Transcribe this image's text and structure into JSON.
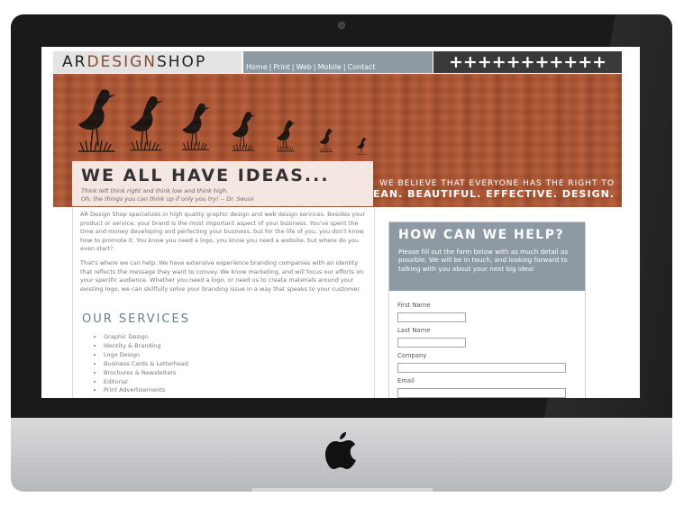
{
  "site": {
    "logo": {
      "left": "AR",
      "middle": "DESIGN",
      "right": "SHOP"
    },
    "nav": [
      "Home",
      "Print",
      "Web",
      "Mobile",
      "Contact"
    ],
    "nav_separator": "|",
    "plus_row": "+++++++++++"
  },
  "banner": {
    "tagline_line1": "WE BELIEVE THAT EVERYONE HAS THE RIGHT TO",
    "tagline_line2": "CLEAN. BEAUTIFUL. EFFECTIVE. DESIGN."
  },
  "intro": {
    "title": "WE ALL HAVE IDEAS...",
    "quote_line1": "Think left think right and think low and think high.",
    "quote_line2": "Oh, the things you can think up if only you try! -- Dr. Seuss",
    "paragraph1": "AR Design Shop specializes in high quality graphic design and web design services. Besides your product or service, your brand is the most important aspect of your business. You've spent the time and money developing and perfecting your business, but for the life of you, you don't know how to promote it. You know you need a logo, you know you need a website, but where do you even start?",
    "paragraph2": "That's where we can help. We have extensive experience branding companies with an identity that reflects the message they want to convey. We know marketing, and will focus our efforts on your specific audience. Whether you need a logo, or need us to create materials around your existing logo, we can skillfully solve your branding issue in a way that speaks to your customer."
  },
  "services": {
    "title": "OUR SERVICES",
    "items": [
      "Graphic Design",
      "Identity & Branding",
      "Logo Design",
      "Business Cards & Letterhead",
      "Brochures & Newsletters",
      "Editorial",
      "Print Advertisements"
    ]
  },
  "help": {
    "title": "HOW CAN WE HELP?",
    "text": "Please fill out the form below with as much detail as possible. We will be in touch, and looking forward to talking with you about your next big idea!",
    "fields": {
      "first_name": "First Name",
      "last_name": "Last Name",
      "company": "Company",
      "email": "Email"
    }
  },
  "colors": {
    "bezel": "#1a1a1a",
    "wood": "#a9502f",
    "nav_gray": "#8d99a3",
    "dark_bar": "#3a3a38",
    "services_blue": "#6a7d8c"
  },
  "icons": [
    "apple-logo-icon",
    "heron-silhouette-icon",
    "camera-icon"
  ]
}
